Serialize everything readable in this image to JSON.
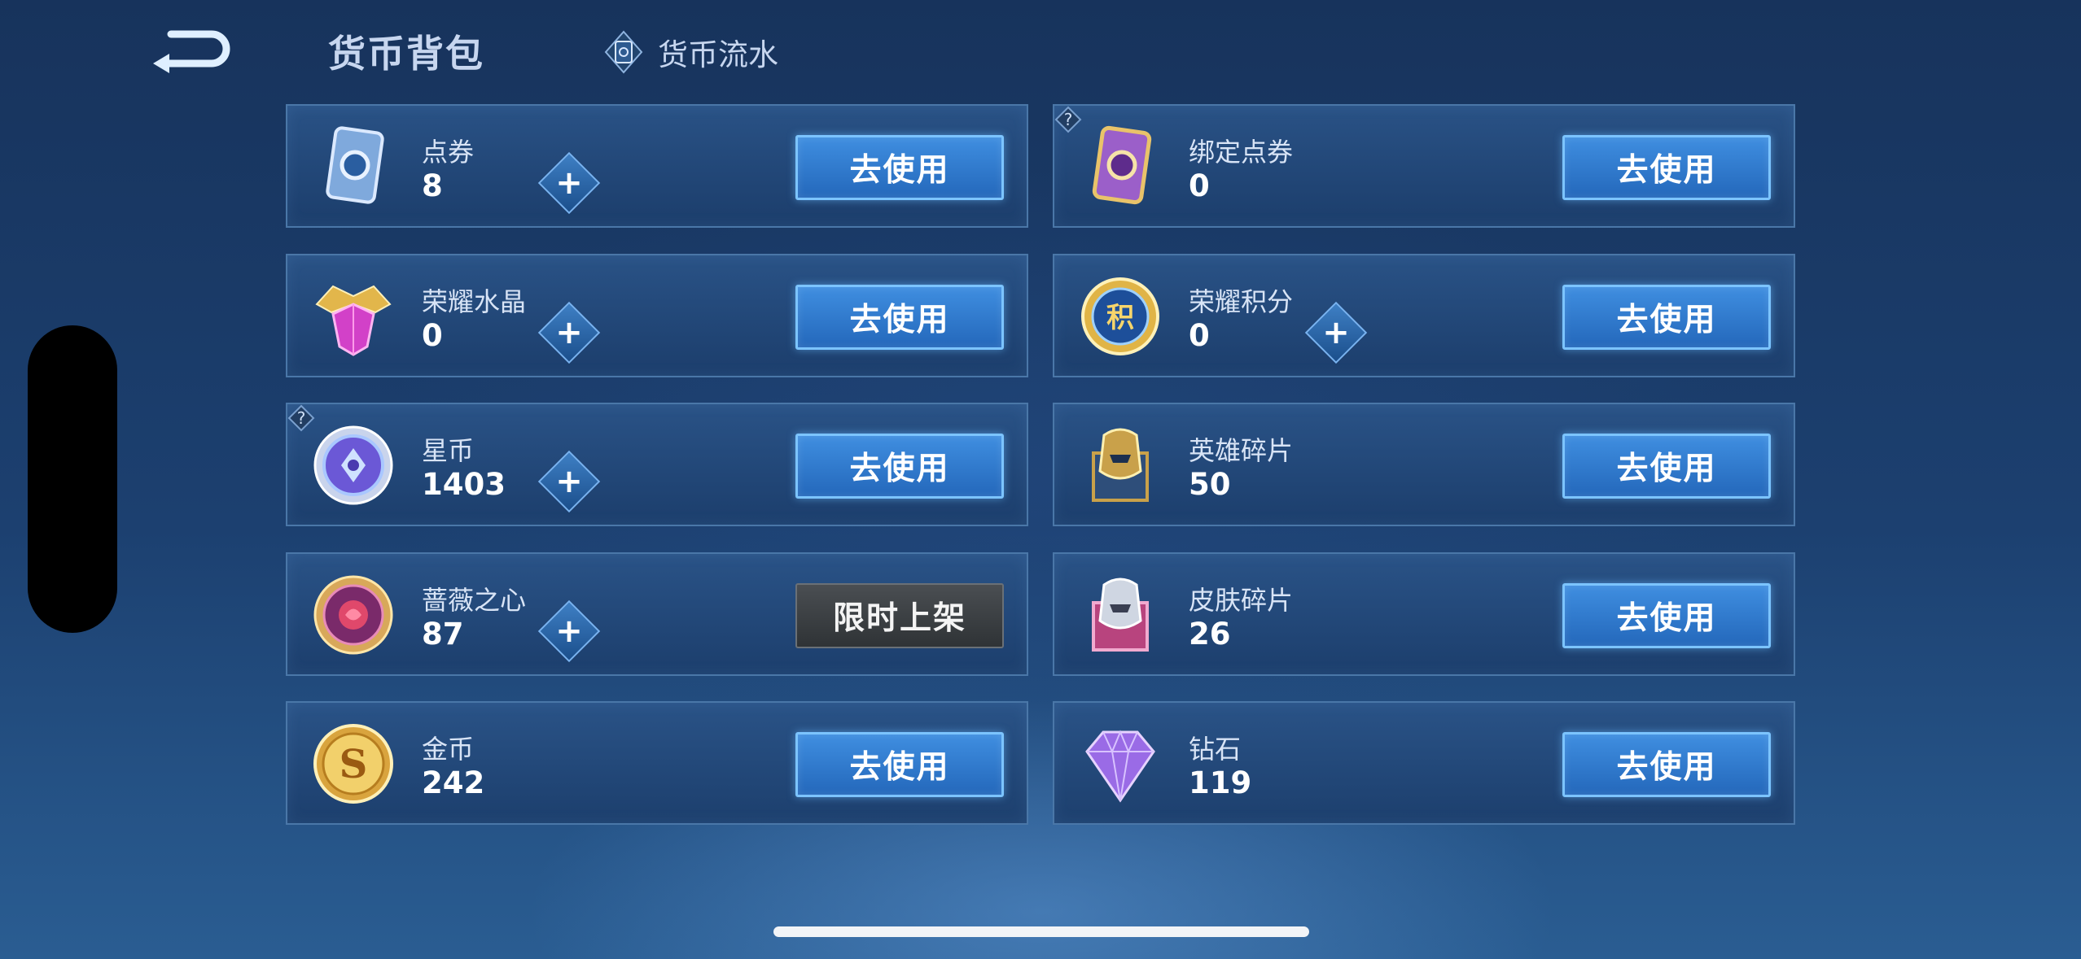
{
  "header": {
    "title": "货币背包",
    "flow_tab": "货币流水"
  },
  "currencies": [
    {
      "name": "点券",
      "amount": "8",
      "action": "去使用"
    },
    {
      "name": "绑定点券",
      "amount": "0",
      "action": "去使用"
    },
    {
      "name": "荣耀水晶",
      "amount": "0",
      "action": "去使用"
    },
    {
      "name": "荣耀积分",
      "amount": "0",
      "action": "去使用"
    },
    {
      "name": "星币",
      "amount": "1403",
      "action": "去使用"
    },
    {
      "name": "英雄碎片",
      "amount": "50",
      "action": "去使用"
    },
    {
      "name": "蔷薇之心",
      "amount": "87",
      "action": "限时上架"
    },
    {
      "name": "皮肤碎片",
      "amount": "26",
      "action": "去使用"
    },
    {
      "name": "金币",
      "amount": "242",
      "action": "去使用"
    },
    {
      "name": "钻石",
      "amount": "119",
      "action": "去使用"
    }
  ],
  "icons": {
    "back": "back-arrow-icon",
    "flow": "ticket-icon",
    "help": "question-icon",
    "plus": "plus-icon"
  },
  "colors": {
    "accent_button": "#3f8ee0",
    "disabled_button": "#4a4e52",
    "card_border": "#4a77a8"
  }
}
